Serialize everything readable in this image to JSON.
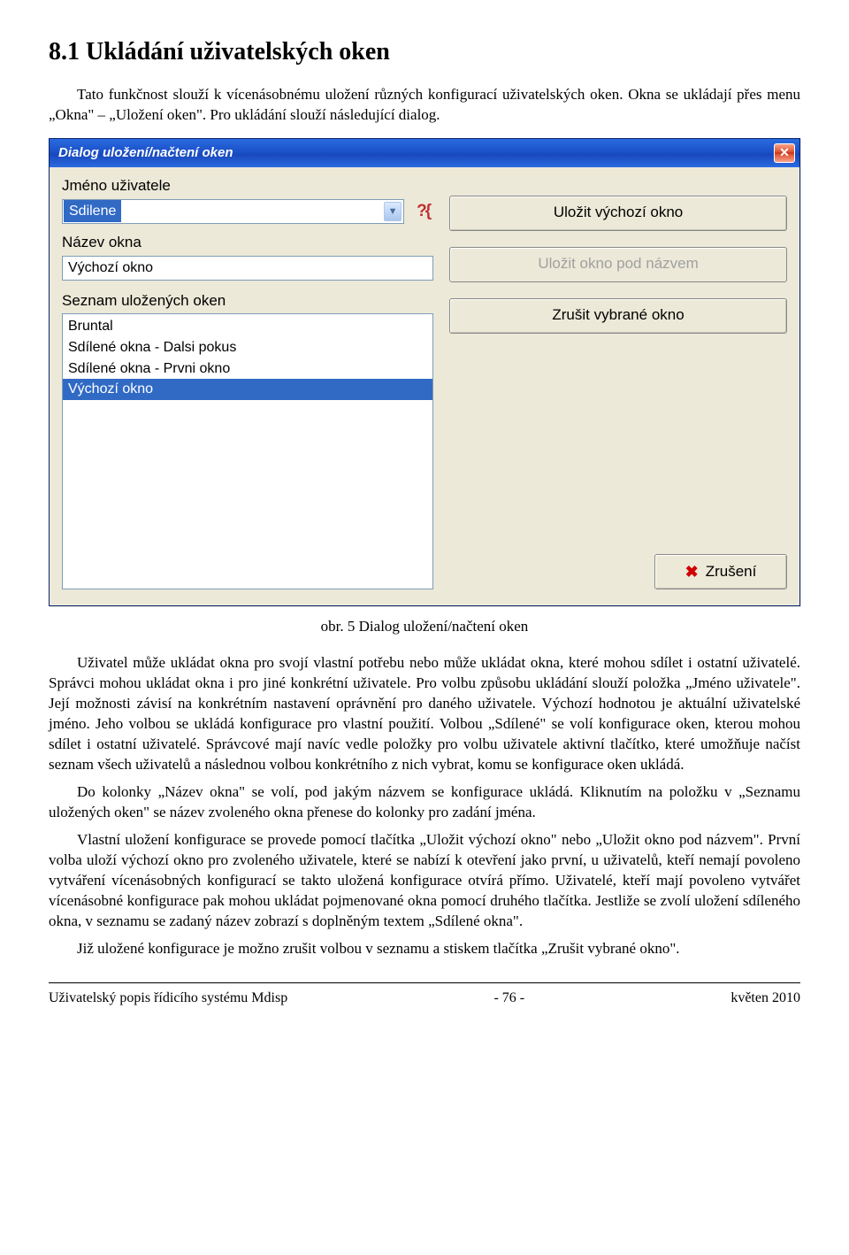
{
  "heading": "8.1  Ukládání uživatelských oken",
  "intro": "Tato funkčnost slouží k vícenásobnému uložení různých konfigurací uživatelských oken. Okna se ukládají přes menu „Okna\" – „Uložení oken\". Pro ukládání slouží následující dialog.",
  "dialog": {
    "title": "Dialog uložení/načtení oken",
    "labels": {
      "username": "Jméno uživatele",
      "windowname": "Název okna",
      "savedlist": "Seznam uložených oken"
    },
    "username_value": "Sdilene",
    "windowname_value": "Výchozí okno",
    "saved_windows": [
      {
        "text": "Bruntal",
        "selected": false
      },
      {
        "text": "Sdílené okna -  Dalsi pokus",
        "selected": false
      },
      {
        "text": "Sdílené okna -  Prvni okno",
        "selected": false
      },
      {
        "text": "Výchozí okno",
        "selected": true
      }
    ],
    "buttons": {
      "save_default": "Uložit výchozí okno",
      "save_named": "Uložit okno pod názvem",
      "delete_selected": "Zrušit vybrané okno",
      "cancel": "Zrušení"
    }
  },
  "figure_caption": "obr.  5   Dialog uložení/načtení oken",
  "paragraphs": [
    "Uživatel může ukládat okna pro svojí vlastní potřebu nebo může ukládat okna, které mohou sdílet i ostatní uživatelé. Správci mohou ukládat okna i pro jiné konkrétní uživatele. Pro volbu způsobu ukládání slouží položka „Jméno uživatele\". Její možnosti závisí na konkrétním nastavení oprávnění pro daného uživatele. Výchozí hodnotou je aktuální uživatelské jméno. Jeho volbou se ukládá konfigurace pro vlastní použití. Volbou „Sdílené\" se volí konfigurace oken, kterou mohou sdílet i ostatní uživatelé. Správcové mají navíc vedle položky pro volbu uživatele aktivní tlačítko, které umožňuje načíst seznam všech uživatelů a následnou volbou konkrétního z nich vybrat, komu se konfigurace oken ukládá.",
    "Do kolonky „Název okna\" se volí, pod jakým názvem se konfigurace ukládá. Kliknutím na položku v „Seznamu uložených oken\" se název zvoleného okna přenese do kolonky pro zadání jména.",
    "Vlastní uložení konfigurace se provede pomocí tlačítka „Uložit výchozí okno\" nebo „Uložit okno pod názvem\". První volba uloží výchozí okno pro zvoleného uživatele, které se nabízí k otevření jako první, u uživatelů, kteří nemají povoleno vytváření vícenásobných konfigurací se takto uložená konfigurace otvírá přímo. Uživatelé, kteří mají povoleno vytvářet vícenásobné konfigurace pak mohou ukládat pojmenované okna pomocí druhého tlačítka. Jestliže se zvolí uložení sdíleného okna, v seznamu se zadaný název zobrazí s doplněným textem „Sdílené okna\".",
    "Již uložené konfigurace je možno zrušit volbou v seznamu a stiskem tlačítka „Zrušit vybrané okno\"."
  ],
  "footer": {
    "left": "Uživatelský popis řídicího systému Mdisp",
    "center": "- 76 -",
    "right": "květen 2010"
  }
}
